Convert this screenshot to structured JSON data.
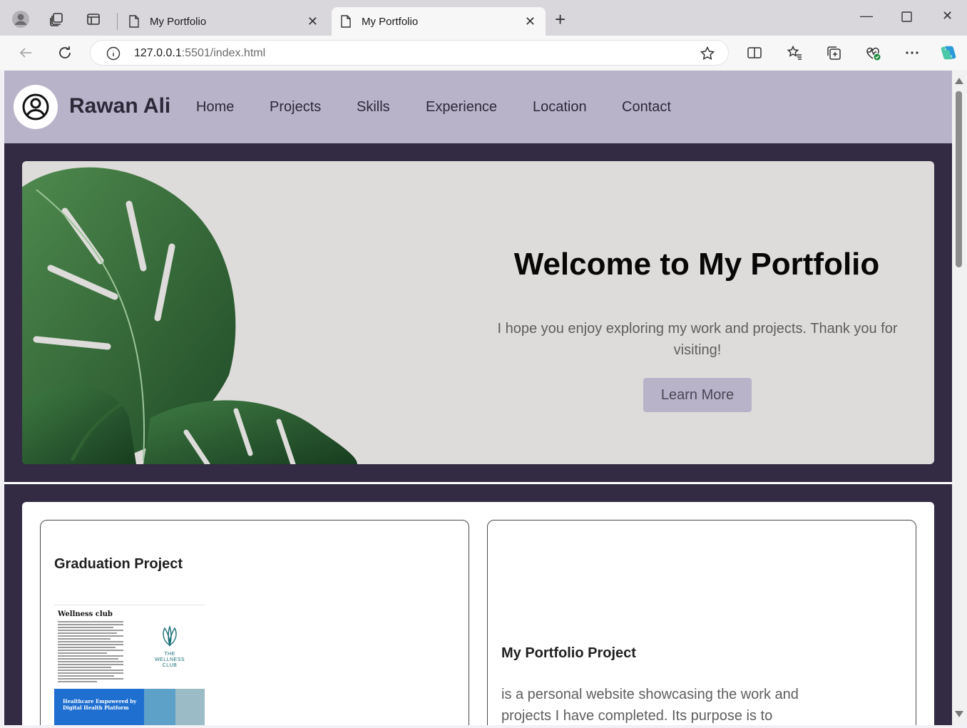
{
  "browser": {
    "tabs": [
      {
        "title": "My Portfolio",
        "active": false
      },
      {
        "title": "My Portfolio",
        "active": true
      }
    ],
    "url_host": "127.0.0.1",
    "url_rest": ":5501/index.html"
  },
  "site": {
    "brand": "Rawan Ali",
    "nav": [
      "Home",
      "Projects",
      "Skills",
      "Experience",
      "Location",
      "Contact"
    ]
  },
  "hero": {
    "title": "Welcome to My Portfolio",
    "text": "I hope you enjoy exploring my work and projects. Thank you for visiting!",
    "button": "Learn More"
  },
  "projects": {
    "cards": [
      {
        "title": "Graduation Project",
        "thumb_title": "Wellness club",
        "thumb_logo": "THE WELLNESS CLUB",
        "thumb_banner": "Healthcare Empowered by Digital Health Platform"
      },
      {
        "title": "My Portfolio Project",
        "text": "is a personal website showcasing the work and projects I have completed. Its purpose is to"
      }
    ]
  },
  "colors": {
    "nav_bg": "#b9b3c9",
    "page_bg": "#322b43",
    "hero_bg": "#dedcda"
  }
}
